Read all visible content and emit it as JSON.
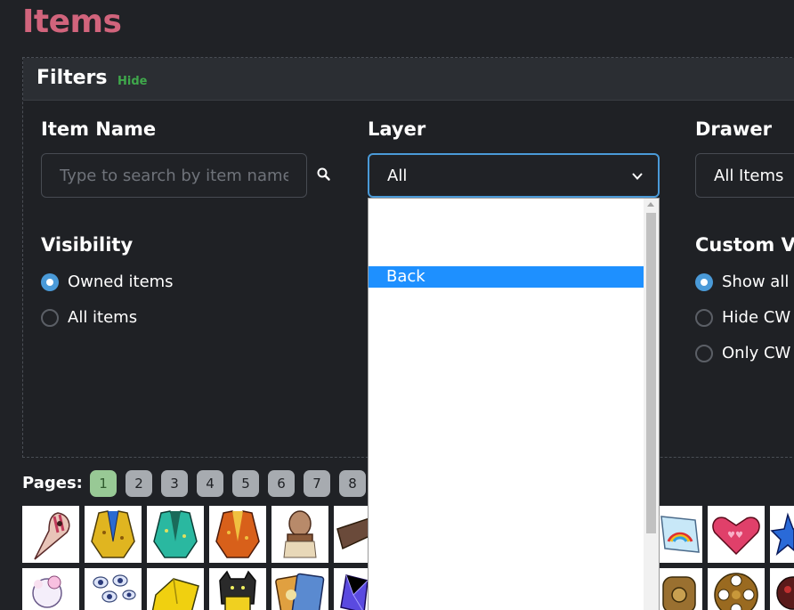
{
  "page": {
    "title": "Items"
  },
  "filters": {
    "title": "Filters",
    "hide_label": "Hide",
    "item_name": {
      "label": "Item Name",
      "placeholder": "Type to search by item name"
    },
    "layer": {
      "label": "Layer",
      "value": "All"
    },
    "drawer": {
      "label": "Drawer",
      "value": "All Items"
    },
    "visibility": {
      "label": "Visibility",
      "options": [
        "Owned items",
        "All items"
      ],
      "selected": "Owned items"
    },
    "custom": {
      "label": "Custom V",
      "options": [
        "Show all",
        "Hide CW",
        "Only CW"
      ],
      "selected": "Show all"
    }
  },
  "dropdown": {
    "options": [
      "",
      "",
      "",
      "Back"
    ],
    "selected": "Back"
  },
  "pagination": {
    "label": "Pages:",
    "pages": [
      "1",
      "2",
      "3",
      "4",
      "5",
      "6",
      "7",
      "8"
    ],
    "current": "1"
  },
  "colors": {
    "accent": "#4a9ad8",
    "title": "#d1647c",
    "hide_link": "#3fa84b",
    "selection": "#1e90ff"
  }
}
